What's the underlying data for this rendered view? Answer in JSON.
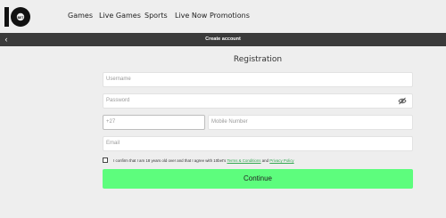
{
  "brand": {
    "logo_text": "10 BET"
  },
  "nav": [
    "Games",
    "Live Games",
    "Sports",
    "Live Now",
    "Promotions"
  ],
  "header": {
    "back_glyph": "‹",
    "title": "Create account"
  },
  "form": {
    "title": "Registration",
    "username_placeholder": "Username",
    "password_placeholder": "Password",
    "prefix_value": "+27",
    "mobile_placeholder": "Mobile Number",
    "email_placeholder": "Email"
  },
  "consent": {
    "text_before": "I confirm that I am 18 years old over and that I agree with 10bet's ",
    "terms_label": "Terms & Conditions",
    "text_and": " and ",
    "privacy_label": "Privacy Policy",
    "checked": false
  },
  "actions": {
    "continue_label": "Continue"
  },
  "colors": {
    "accent": "#5dfd7d",
    "bar": "#3a3a3a",
    "link": "#33a852",
    "background": "#eeeeee"
  }
}
